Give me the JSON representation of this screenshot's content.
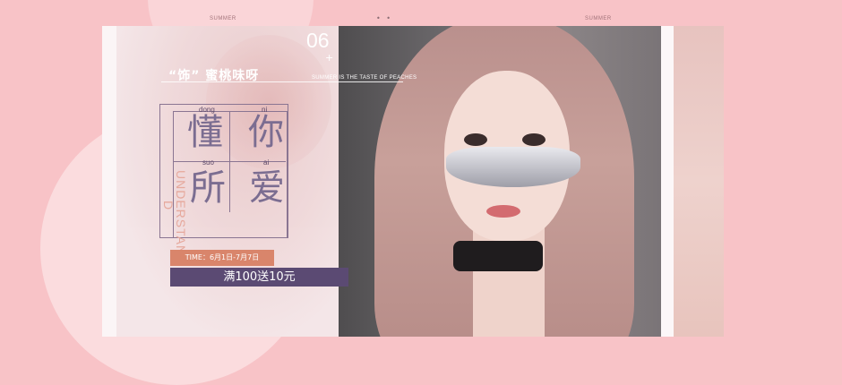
{
  "banner": {
    "season_left": "SUMMER",
    "season_right": "SUMMER",
    "dots": "• •",
    "issue_number": "06",
    "plus": "+",
    "subtitle": "“饰” 蜜桃味呀",
    "tagline": "SUMMER IS THE TASTE OF PEACHES"
  },
  "headline": {
    "chars": [
      {
        "pinyin": "dong",
        "hanzi": "懂"
      },
      {
        "pinyin": "ni",
        "hanzi": "你"
      },
      {
        "pinyin": "suo",
        "hanzi": "所"
      },
      {
        "pinyin": "ai",
        "hanzi": "爱"
      }
    ],
    "vertical_text": "UNDERSTAN",
    "vertical_letter": "D"
  },
  "promo": {
    "time": "TIME：6月1日-7月7日",
    "offer": "满100送10元"
  },
  "colors": {
    "background": "#f8c3c7",
    "accent_purple": "#5b4a73",
    "accent_coral": "#d9856b"
  }
}
